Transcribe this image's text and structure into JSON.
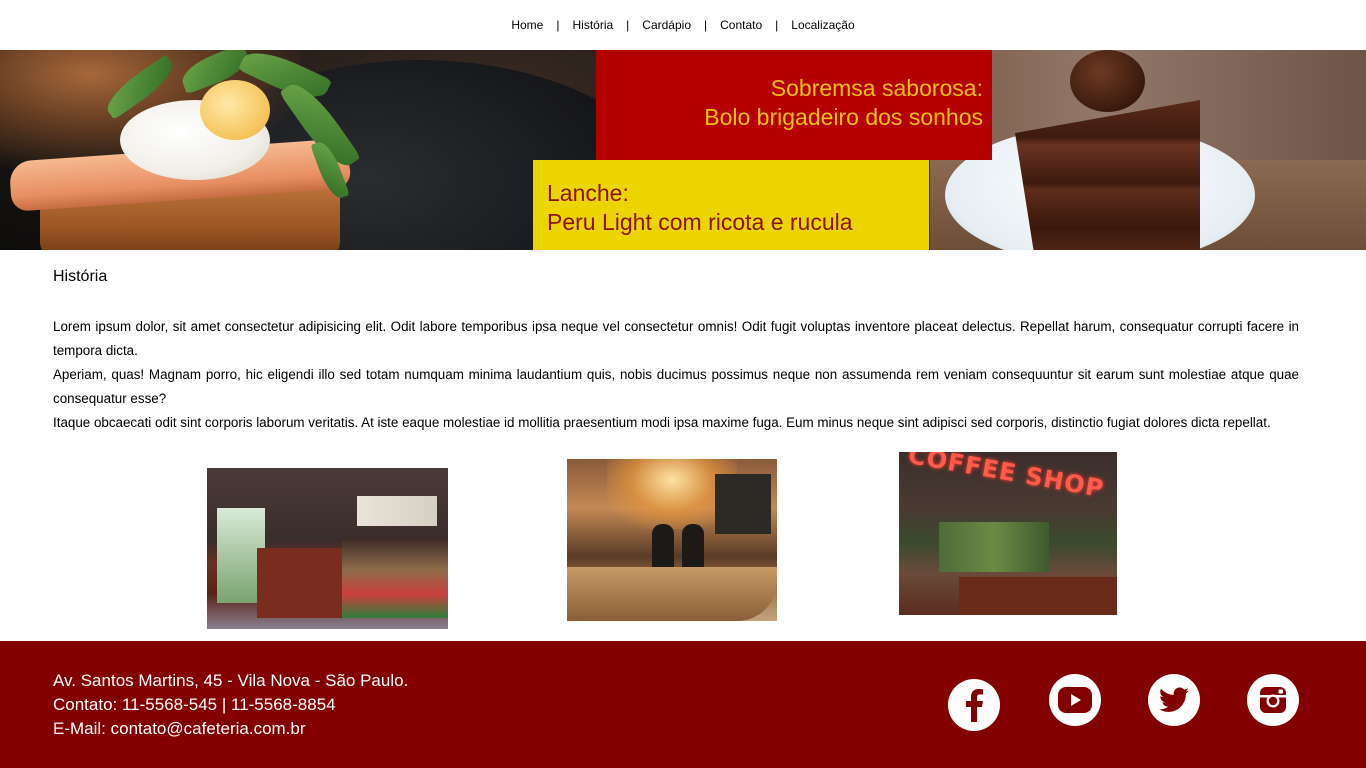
{
  "nav": {
    "items": [
      "Home",
      "História",
      "Cardápio",
      "Contato",
      "Localização"
    ],
    "separator": "|"
  },
  "hero": {
    "dessert_line1": "Sobremsa saborosa:",
    "dessert_line2": "Bolo brigadeiro dos sonhos",
    "snack_line1": "Lanche:",
    "snack_line2": "Peru Light com ricota e rucula"
  },
  "content": {
    "title": "História",
    "paragraphs": [
      "Lorem ipsum dolor, sit amet consectetur adipisicing elit. Odit labore temporibus ipsa neque vel consectetur omnis! Odit fugit voluptas inventore placeat delectus. Repellat harum, consequatur corrupti facere in tempora dicta.",
      "Aperiam, quas! Magnam porro, hic eligendi illo sed totam numquam minima laudantium quis, nobis ducimus possimus neque non assumenda rem veniam consequuntur sit earum sunt molestiae atque quae consequatur esse?",
      "Itaque obcaecati odit sint corporis laborum veritatis. At iste eaque molestiae id mollitia praesentium modi ipsa maxime fuga. Eum minus neque sint adipisci sed corporis, distinctio fugiat dolores dicta repellat."
    ],
    "photo3_sign": "COFFEE SHOP"
  },
  "footer": {
    "address": "Av. Santos Martins, 45 - Vila Nova - São Paulo.",
    "phone": "Contato: 11-5568-545 | 11-5568-8854",
    "email": "E-Mail: contato@cafeteria.com.br"
  },
  "social_icons": [
    "facebook-icon",
    "youtube-icon",
    "twitter-icon",
    "instagram-icon"
  ],
  "colors": {
    "footer_bg": "#820000",
    "red_box": "#b50000",
    "red_box_text": "#f0c018",
    "yellow_box": "#ecd400",
    "yellow_box_text": "#8a1200"
  }
}
